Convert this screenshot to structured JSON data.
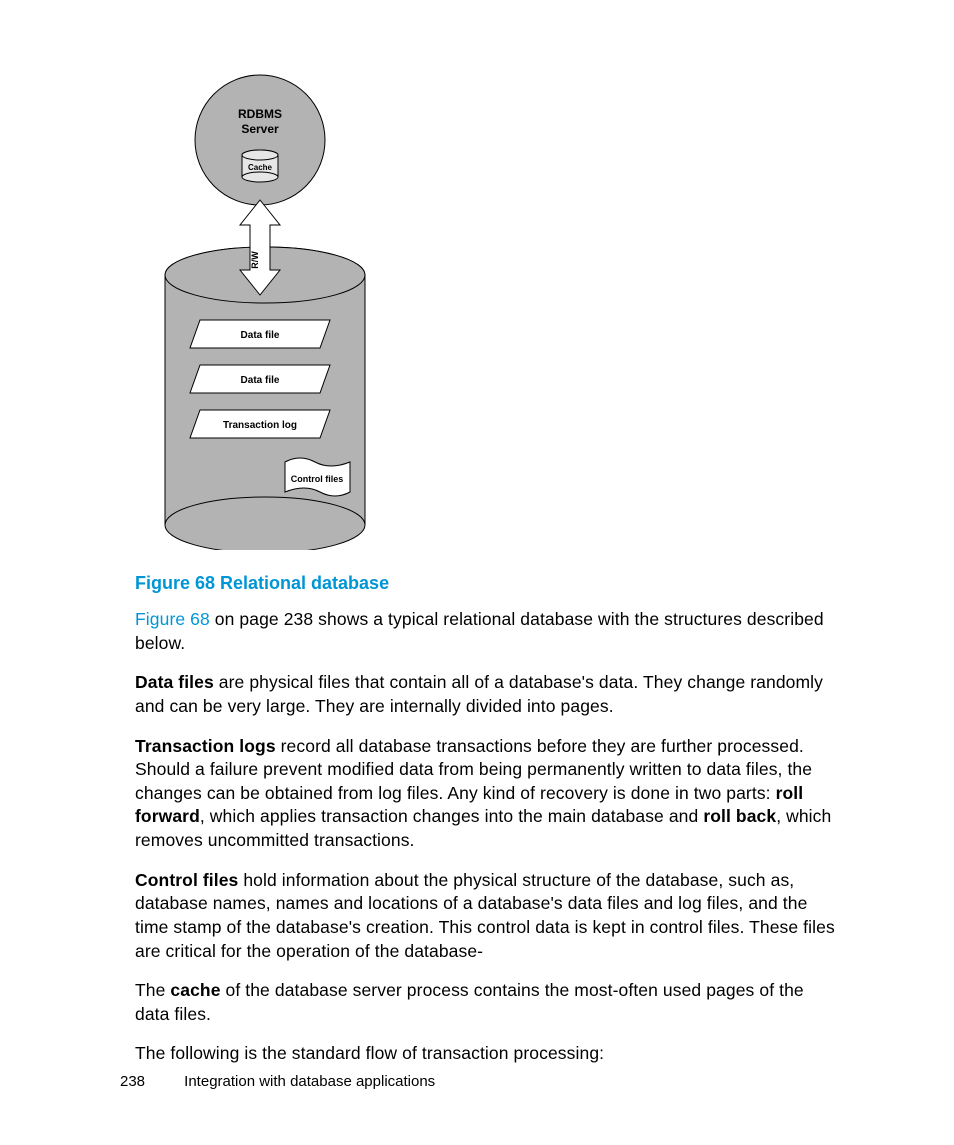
{
  "diagram": {
    "server_line1": "RDBMS",
    "server_line2": "Server",
    "cache": "Cache",
    "arrow": "R/W",
    "box1": "Data file",
    "box2": "Data file",
    "box3": "Transaction log",
    "flag": "Control files"
  },
  "figcaption": "Figure 68 Relational database",
  "p1_link": "Figure 68",
  "p1_rest": " on page 238 shows a typical relational database with the structures described below.",
  "p2_b": "Data files",
  "p2_rest": " are physical files that contain all of a database's data. They change randomly and can be very large. They are internally divided into pages.",
  "p3_b1": "Transaction logs",
  "p3_mid1": " record all database transactions before they are further processed. Should a failure prevent modified data from being permanently written to data files, the changes can be obtained from log files. Any kind of recovery is done in two parts: ",
  "p3_b2": "roll forward",
  "p3_mid2": ", which applies transaction changes into the main database and ",
  "p3_b3": "roll back",
  "p3_rest": ", which removes uncommitted transactions.",
  "p4_b": "Control files",
  "p4_rest": " hold information about the physical structure of the database, such as, database names, names and locations of a database's data files and log files, and the time stamp of the database's creation. This control data is kept in control files. These files are critical for the operation of the database-",
  "p5_pre": "The ",
  "p5_b": "cache",
  "p5_rest": " of the database server process contains the most-often used pages of the data files.",
  "p6": "The following is the standard flow of transaction processing:",
  "footer_page": "238",
  "footer_title": "Integration with database applications"
}
